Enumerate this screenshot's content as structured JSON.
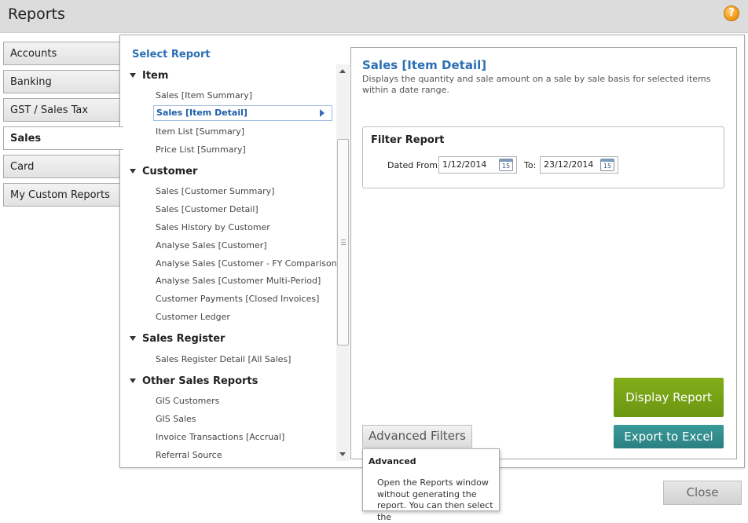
{
  "window": {
    "title": "Reports",
    "help_icon": "?"
  },
  "nav": {
    "tabs": [
      {
        "label": "Accounts"
      },
      {
        "label": "Banking"
      },
      {
        "label": "GST / Sales Tax"
      },
      {
        "label": "Sales",
        "active": true
      },
      {
        "label": "Card"
      },
      {
        "label": "My Custom Reports"
      }
    ]
  },
  "select_report": {
    "title": "Select Report",
    "groups": [
      {
        "label": "Item",
        "items": [
          "Sales [Item Summary]",
          "Sales [Item Detail]",
          "Item List [Summary]",
          "Price List [Summary]"
        ]
      },
      {
        "label": "Customer",
        "items": [
          "Sales [Customer Summary]",
          "Sales [Customer Detail]",
          "Sales History by Customer",
          "Analyse Sales [Customer]",
          "Analyse Sales [Customer - FY Comparison]",
          "Analyse Sales [Customer Multi-Period]",
          "Customer Payments [Closed Invoices]",
          "Customer Ledger"
        ]
      },
      {
        "label": "Sales Register",
        "items": [
          "Sales Register Detail [All Sales]"
        ]
      },
      {
        "label": "Other Sales Reports",
        "items": [
          "GIS Customers",
          "GIS Sales",
          "Invoice Transactions [Accrual]",
          "Referral Source"
        ]
      }
    ],
    "selected_item": "Sales [Item Detail]"
  },
  "report": {
    "title": "Sales [Item Detail]",
    "description": "Displays the quantity and sale amount on a sale by sale basis for selected items within a date range.",
    "filter": {
      "title": "Filter Report",
      "dated_from_label": "Dated From:",
      "dated_from_value": "1/12/2014",
      "to_label": "To:",
      "to_value": "23/12/2014",
      "calendar_day": "15"
    }
  },
  "buttons": {
    "display_report": "Display Report",
    "export_excel": "Export to Excel",
    "advanced_filters": "Advanced Filters",
    "close": "Close"
  },
  "tooltip": {
    "title": "Advanced",
    "body": "Open the Reports window without generating the report. You can then select the"
  },
  "colors": {
    "accent_blue": "#2c6fb5",
    "display_green": "#74a115",
    "export_teal": "#2f8a8b"
  }
}
